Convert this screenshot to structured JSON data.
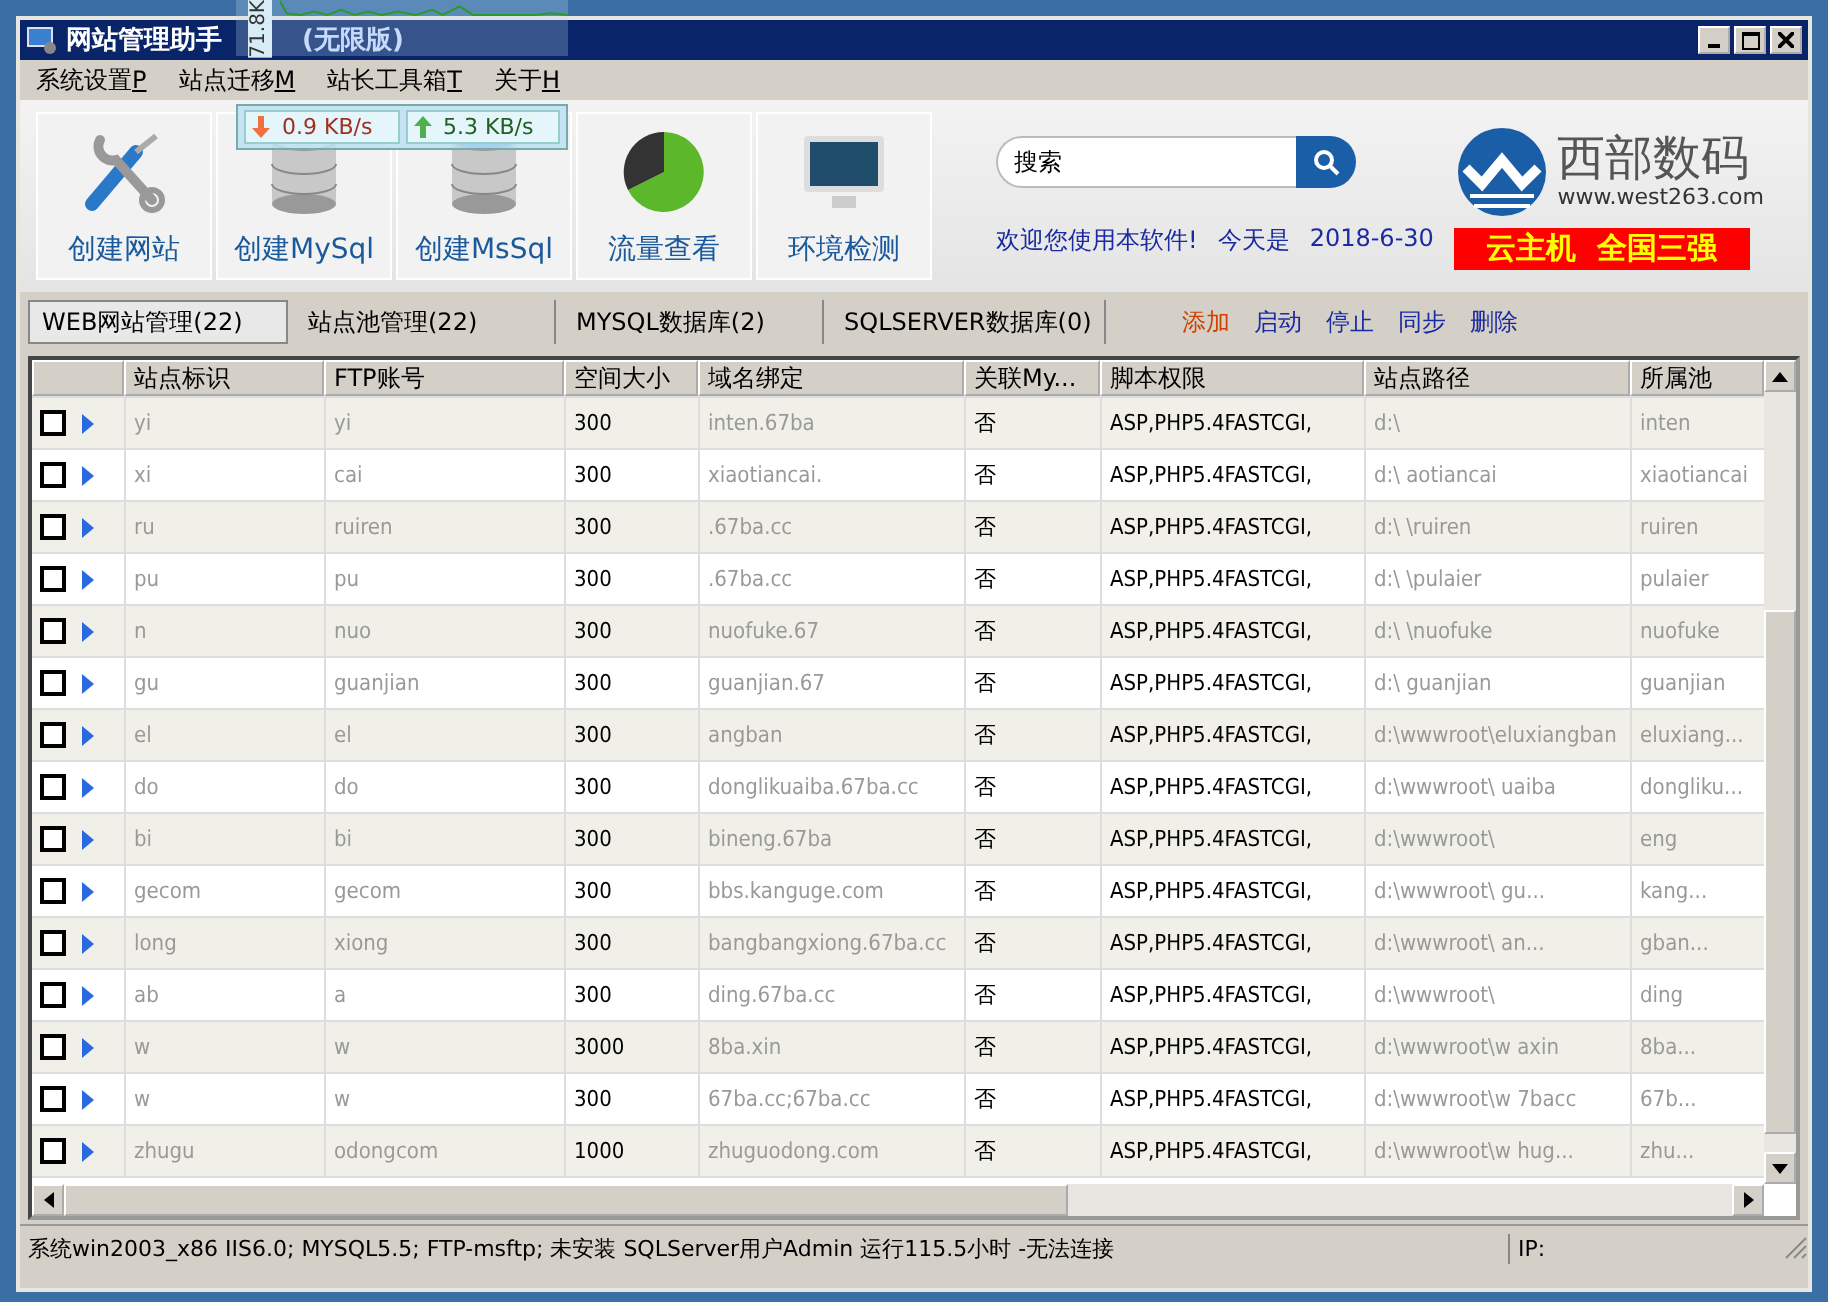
{
  "window": {
    "title": "网站管理助手",
    "edition": "(无限版)"
  },
  "menu": [
    {
      "label": "系统设置",
      "key": "P"
    },
    {
      "label": "站点迁移",
      "key": "M"
    },
    {
      "label": "站长工具箱",
      "key": "T"
    },
    {
      "label": "关于",
      "key": "H"
    }
  ],
  "speed_widget": {
    "axis_label": "71.8K",
    "download": "0.9 KB/s",
    "upload": "5.3 KB/s"
  },
  "toolbar": [
    {
      "kind": "tools",
      "label": "创建网站"
    },
    {
      "kind": "mysql",
      "label": "创建MySql"
    },
    {
      "kind": "mssql",
      "label": "创建MsSql"
    },
    {
      "kind": "traffic",
      "label": "流量查看"
    },
    {
      "kind": "monitor",
      "label": "环境检测"
    }
  ],
  "search": {
    "placeholder": "搜索"
  },
  "welcome": "欢迎您使用本软件!",
  "today_label": "今天是",
  "date": "2018-6-30",
  "logo": {
    "name": "西部数码",
    "url": "www.west263.com",
    "banner": "云主机  全国三强"
  },
  "tabs": [
    {
      "label": "WEB网站管理(22)",
      "selected": true
    },
    {
      "label": "站点池管理(22)",
      "selected": false
    },
    {
      "label": "MYSQL数据库(2)",
      "selected": false
    },
    {
      "label": "SQLSERVER数据库(0)",
      "selected": false
    }
  ],
  "actions": [
    {
      "label": "添加",
      "kind": "primary"
    },
    {
      "label": "启动",
      "kind": "normal"
    },
    {
      "label": "停止",
      "kind": "normal"
    },
    {
      "label": "同步",
      "kind": "normal"
    },
    {
      "label": "删除",
      "kind": "normal"
    }
  ],
  "table": {
    "columns": [
      "站点标识",
      "FTP账号",
      "空间大小",
      "域名绑定",
      "关联My...",
      "脚本权限",
      "站点路径",
      "所属池"
    ],
    "rows": [
      {
        "checked": false,
        "cells": [
          "yi",
          "yi",
          "300",
          "inten.67ba",
          "否",
          "ASP,PHP5.4FASTCGI,",
          "d:\\",
          "inten"
        ]
      },
      {
        "checked": false,
        "cells": [
          "xi",
          "cai",
          "300",
          "xiaotiancai.",
          "否",
          "ASP,PHP5.4FASTCGI,",
          "d:\\    aotiancai",
          "xiaotiancai"
        ]
      },
      {
        "checked": false,
        "cells": [
          "ru",
          "ruiren",
          "300",
          ".67ba.cc",
          "否",
          "ASP,PHP5.4FASTCGI,",
          "d:\\    \\ruiren",
          "ruiren"
        ]
      },
      {
        "checked": false,
        "cells": [
          "pu",
          "pu",
          "300",
          ".67ba.cc",
          "否",
          "ASP,PHP5.4FASTCGI,",
          "d:\\    \\pulaier",
          "pulaier"
        ]
      },
      {
        "checked": false,
        "cells": [
          "n",
          "nuo",
          "300",
          "nuofuke.67",
          "否",
          "ASP,PHP5.4FASTCGI,",
          "d:\\    \\nuofuke",
          "nuofuke"
        ]
      },
      {
        "checked": false,
        "cells": [
          "gu",
          "guanjian",
          "300",
          "guanjian.67",
          "否",
          "ASP,PHP5.4FASTCGI,",
          "d:\\    guanjian",
          "guanjian"
        ]
      },
      {
        "checked": false,
        "cells": [
          "el",
          "el",
          "300",
          "angban",
          "否",
          "ASP,PHP5.4FASTCGI,",
          "d:\\wwwroot\\eluxiangban",
          "eluxiang..."
        ]
      },
      {
        "checked": false,
        "cells": [
          "do",
          "do",
          "300",
          "donglikuaiba.67ba.cc",
          "否",
          "ASP,PHP5.4FASTCGI,",
          "d:\\wwwroot\\    uaiba",
          "dongliku..."
        ]
      },
      {
        "checked": false,
        "cells": [
          "bi",
          "bi",
          "300",
          "bineng.67ba",
          "否",
          "ASP,PHP5.4FASTCGI,",
          "d:\\wwwroot\\",
          "eng"
        ]
      },
      {
        "checked": false,
        "cells": [
          "gecom",
          "gecom",
          "300",
          "bbs.kanguge.com",
          "否",
          "ASP,PHP5.4FASTCGI,",
          "d:\\wwwroot\\    gu...",
          "kang..."
        ]
      },
      {
        "checked": false,
        "cells": [
          "long",
          "xiong",
          "300",
          "bangbangxiong.67ba.cc",
          "否",
          "ASP,PHP5.4FASTCGI,",
          "d:\\wwwroot\\    an...",
          "gban..."
        ]
      },
      {
        "checked": false,
        "cells": [
          "ab",
          "a",
          "300",
          "ding.67ba.cc",
          "否",
          "ASP,PHP5.4FASTCGI,",
          "d:\\wwwroot\\",
          "ding"
        ]
      },
      {
        "checked": false,
        "cells": [
          "w",
          "w",
          "3000",
          "8ba.xin",
          "否",
          "ASP,PHP5.4FASTCGI,",
          "d:\\wwwroot\\w    axin",
          "8ba..."
        ]
      },
      {
        "checked": false,
        "cells": [
          "w",
          "w",
          "300",
          "67ba.cc;67ba.cc",
          "否",
          "ASP,PHP5.4FASTCGI,",
          "d:\\wwwroot\\w    7bacc",
          "67b..."
        ]
      },
      {
        "checked": false,
        "cells": [
          "zhugu",
          "odongcom",
          "1000",
          "zhuguodong.com",
          "否",
          "ASP,PHP5.4FASTCGI,",
          "d:\\wwwroot\\w    hug...",
          "zhu..."
        ]
      }
    ]
  },
  "status_bar": {
    "info": "系统win2003_x86 IIS6.0; MYSQL5.5; FTP-msftp; 未安装 SQLServer用户Admin 运行115.5小时 -无法连接",
    "ip": "IP:"
  }
}
